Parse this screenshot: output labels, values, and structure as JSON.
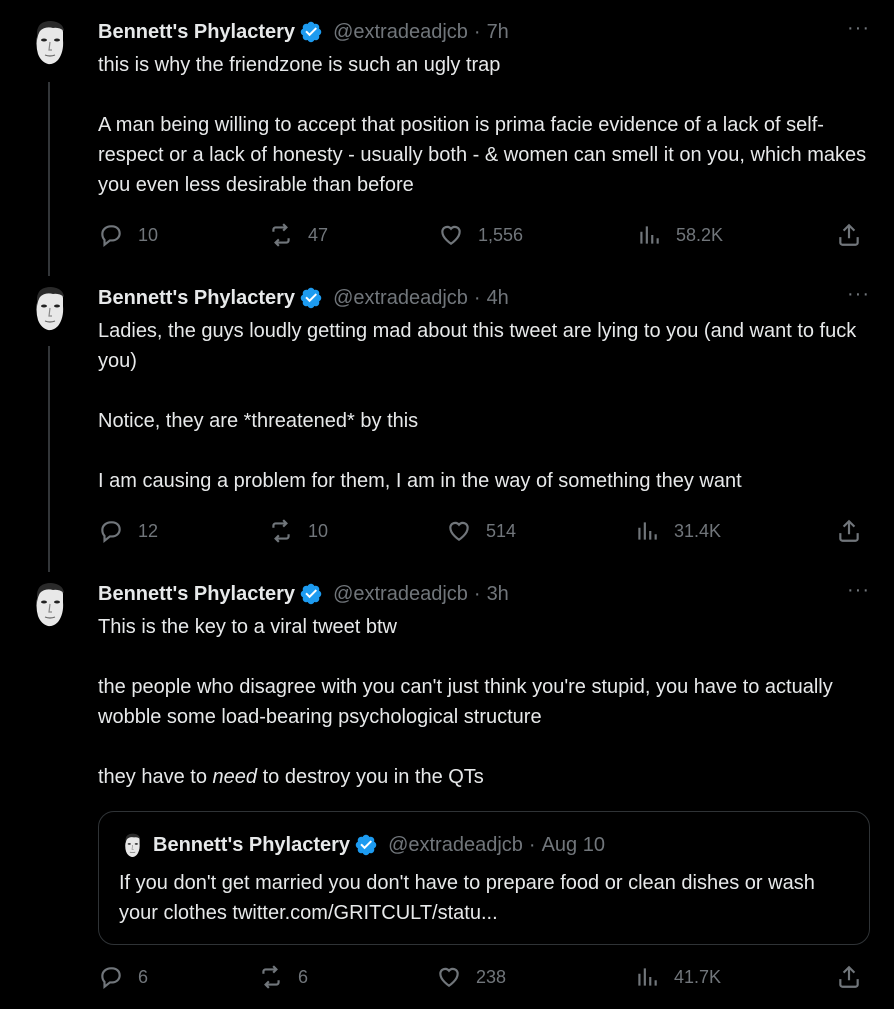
{
  "author": {
    "name": "Bennett's Phylactery",
    "handle": "@extradeadjcb",
    "verified_color": "#1d9bf0"
  },
  "tweets": [
    {
      "time": "7h",
      "paragraphs": [
        "this is why the friendzone is such an ugly trap",
        "A man being willing to accept that position is prima facie evidence of a lack of self-respect or a lack of honesty - usually both - & women can smell it on you, which makes you even less desirable than before"
      ],
      "stats": {
        "replies": "10",
        "retweets": "47",
        "likes": "1,556",
        "views": "58.2K"
      }
    },
    {
      "time": "4h",
      "paragraphs": [
        "Ladies, the guys loudly getting mad about this tweet are lying to you (and want to fuck you)",
        "Notice, they are *threatened* by this",
        "I am causing a problem for them, I am in the way of something they want"
      ],
      "stats": {
        "replies": "12",
        "retweets": "10",
        "likes": "514",
        "views": "31.4K"
      }
    },
    {
      "time": "3h",
      "paragraphs": [
        "This is the key to a viral tweet btw",
        "the people who disagree with you can't just think you're stupid, you have to actually wobble some load-bearing psychological structure"
      ],
      "last_pre": "they have to ",
      "last_em": "need",
      "last_post": " to destroy you in the QTs",
      "quote": {
        "time": "Aug 10",
        "text": "If you don't get married you don't have to prepare food or clean dishes or wash your clothes twitter.com/GRITCULT/statu..."
      },
      "stats": {
        "replies": "6",
        "retweets": "6",
        "likes": "238",
        "views": "41.7K"
      }
    }
  ],
  "separator": "·",
  "more_label": "···"
}
